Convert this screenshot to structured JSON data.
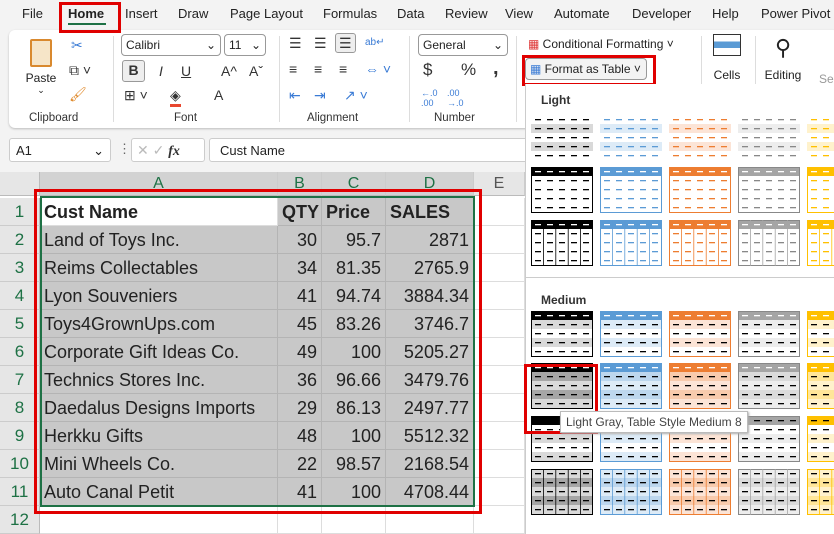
{
  "menu_tabs": [
    "File",
    "Home",
    "Insert",
    "Draw",
    "Page Layout",
    "Formulas",
    "Data",
    "Review",
    "View",
    "Automate",
    "Developer",
    "Help",
    "Power Pivot"
  ],
  "active_tab": "Home",
  "ribbon": {
    "clipboard": {
      "paste": "Paste",
      "group": "Clipboard"
    },
    "font": {
      "name": "Calibri",
      "size": "11",
      "group": "Font",
      "bold": "B",
      "italic": "I",
      "underline": "U",
      "grow": "A^",
      "shrink": "Aˇ",
      "color_letter": "A"
    },
    "alignment": {
      "group": "Alignment"
    },
    "number": {
      "format": "General",
      "group": "Number",
      "currency": "$",
      "percent": "%",
      "comma": ",",
      "inc_dec": "←.0 .00",
      "dec_dec": ".00 →.0"
    },
    "styles": {
      "conditional": "Conditional Formatting",
      "format_table": "Format as Table"
    },
    "cells": "Cells",
    "editing": "Editing",
    "sensitivity": "Se"
  },
  "formula_bar": {
    "name_box": "A1",
    "fx": "fx",
    "value": "Cust Name"
  },
  "columns": [
    "A",
    "B",
    "C",
    "D",
    "E"
  ],
  "rows": [
    [
      "Cust Name",
      "QTY",
      "Price",
      "SALES"
    ],
    [
      "Land of Toys Inc.",
      "30",
      "95.7",
      "2871"
    ],
    [
      "Reims Collectables",
      "34",
      "81.35",
      "2765.9"
    ],
    [
      "Lyon Souveniers",
      "41",
      "94.74",
      "3884.34"
    ],
    [
      "Toys4GrownUps.com",
      "45",
      "83.26",
      "3746.7"
    ],
    [
      "Corporate Gift Ideas Co.",
      "49",
      "100",
      "5205.27"
    ],
    [
      "Technics Stores Inc.",
      "36",
      "96.66",
      "3479.76"
    ],
    [
      "Daedalus Designs Imports",
      "29",
      "86.13",
      "2497.77"
    ],
    [
      "Herkku Gifts",
      "48",
      "100",
      "5512.32"
    ],
    [
      "Mini Wheels Co.",
      "22",
      "98.57",
      "2168.54"
    ],
    [
      "Auto Canal Petit",
      "41",
      "100",
      "4708.44"
    ]
  ],
  "row_numbers": [
    "1",
    "2",
    "3",
    "4",
    "5",
    "6",
    "7",
    "8",
    "9",
    "10",
    "11",
    "12"
  ],
  "gallery": {
    "light_label": "Light",
    "medium_label": "Medium",
    "tooltip": "Light Gray, Table Style Medium 8",
    "palette": [
      "#000000",
      "#5b9bd5",
      "#ed7d31",
      "#a5a5a5",
      "#ffc000"
    ]
  },
  "colors": {
    "accent": "#1e7145",
    "highlight": "#e00000",
    "selection": "#c8c8c8"
  }
}
